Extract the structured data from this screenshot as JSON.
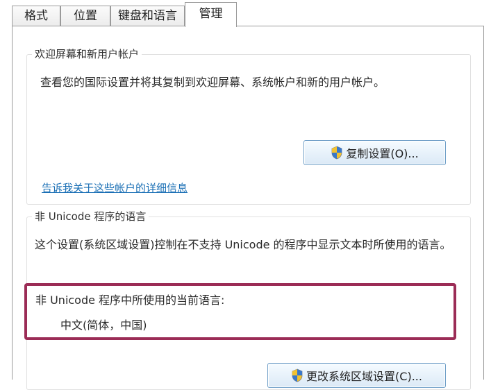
{
  "tabs": [
    {
      "label": "格式"
    },
    {
      "label": "位置"
    },
    {
      "label": "键盘和语言"
    },
    {
      "label": "管理"
    }
  ],
  "welcome_group": {
    "title": "欢迎屏幕和新用户帐户",
    "description": "查看您的国际设置并将其复制到欢迎屏幕、系统帐户和新的用户帐户。",
    "copy_button": "复制设置(O)...",
    "link": "告诉我关于这些帐户的详细信息"
  },
  "nonunicode_group": {
    "title": "非 Unicode 程序的语言",
    "description": "这个设置(系统区域设置)控制在不支持 Unicode 的程序中显示文本时所使用的语言。",
    "current_label": "非 Unicode 程序中所使用的当前语言:",
    "current_value": "中文(简体，中国)",
    "change_button": "更改系统区域设置(C)..."
  },
  "colors": {
    "highlight": "#9b2c56",
    "link": "#1a6fb5"
  },
  "icons": {
    "shield": "uac-shield-icon"
  }
}
